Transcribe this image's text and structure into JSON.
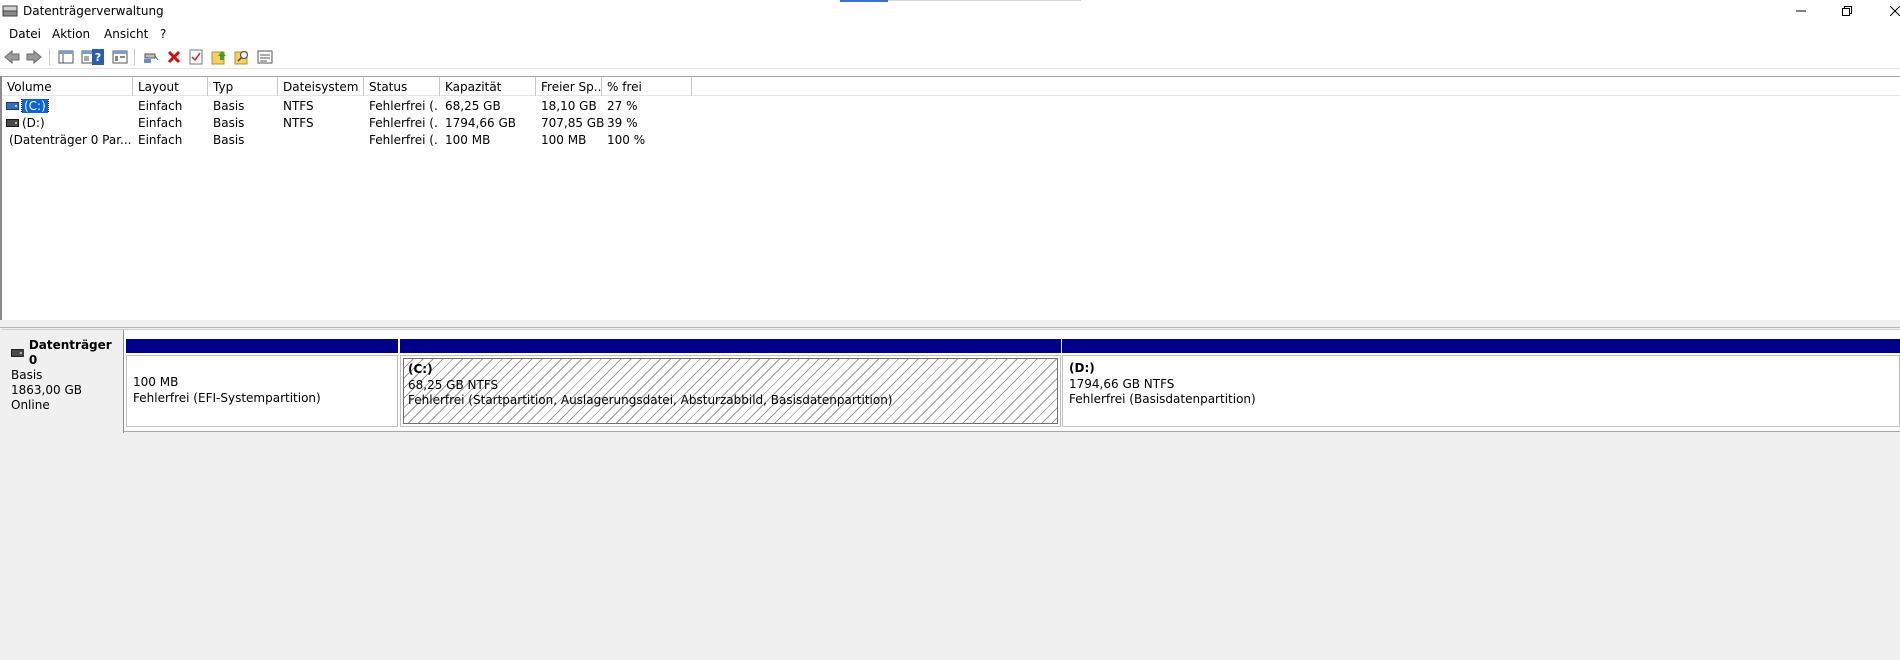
{
  "window": {
    "title": "Datenträgerverwaltung"
  },
  "menu": [
    "Datei",
    "Aktion",
    "Ansicht",
    "?"
  ],
  "toolbar": {
    "icons": [
      "back-icon",
      "forward-icon",
      "properties-icon",
      "help-icon",
      "console-tree-icon",
      "connect-icon",
      "delete-icon",
      "checklist-icon",
      "folder-up-icon",
      "search-folder-icon",
      "list-view-icon"
    ]
  },
  "volume_list": {
    "columns": [
      "Volume",
      "Layout",
      "Typ",
      "Dateisystem",
      "Status",
      "Kapazität",
      "Freier Sp...",
      "% frei"
    ],
    "rows": [
      {
        "volume": "(C:)",
        "layout": "Einfach",
        "typ": "Basis",
        "dateisystem": "NTFS",
        "status": "Fehlerfrei (...",
        "kapazitaet": "68,25 GB",
        "frei": "18,10 GB",
        "prozent": "27 %",
        "selected": true
      },
      {
        "volume": "(D:)",
        "layout": "Einfach",
        "typ": "Basis",
        "dateisystem": "NTFS",
        "status": "Fehlerfrei (...",
        "kapazitaet": "1794,66 GB",
        "frei": "707,85 GB",
        "prozent": "39 %",
        "selected": false
      },
      {
        "volume": "(Datenträger 0 Par...",
        "layout": "Einfach",
        "typ": "Basis",
        "dateisystem": "",
        "status": "Fehlerfrei (...",
        "kapazitaet": "100 MB",
        "frei": "100 MB",
        "prozent": "100 %",
        "selected": false
      }
    ]
  },
  "disk": {
    "name": "Datenträger 0",
    "type": "Basis",
    "size": "1863,00 GB",
    "state": "Online",
    "partitions": [
      {
        "name": "",
        "size": "100 MB",
        "status": "Fehlerfrei (EFI-Systempartition)"
      },
      {
        "name": "(C:)",
        "size": "68,25 GB NTFS",
        "status": "Fehlerfrei (Startpartition, Auslagerungsdatei, Absturzabbild, Basisdatenpartition)"
      },
      {
        "name": "(D:)",
        "size": "1794,66 GB NTFS",
        "status": "Fehlerfrei (Basisdatenpartition)"
      }
    ]
  },
  "colors": {
    "partition_bar": "#00008a",
    "selection": "#0a64d2"
  }
}
